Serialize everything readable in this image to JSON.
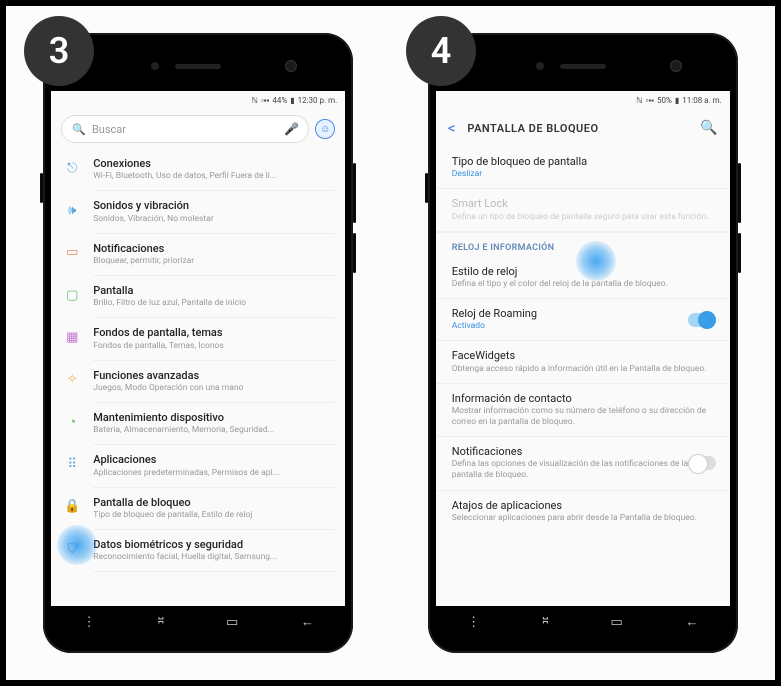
{
  "steps": {
    "s3": "3",
    "s4": "4"
  },
  "screen1": {
    "status": {
      "signalIcon": "📶",
      "battIcon": "▮",
      "battPct": "44%",
      "time": "12:30 p. m."
    },
    "search": {
      "placeholder": "Buscar"
    },
    "items": [
      {
        "title": "Conexiones",
        "sub": "Wi-Fi, Bluetooth, Uso de datos, Perfil Fuera de lí..."
      },
      {
        "title": "Sonidos y vibración",
        "sub": "Sonidos, Vibración, No molestar"
      },
      {
        "title": "Notificaciones",
        "sub": "Bloquear, permitir, priorizar"
      },
      {
        "title": "Pantalla",
        "sub": "Brillo, Filtro de luz azul, Pantalla de inicio"
      },
      {
        "title": "Fondos de pantalla, temas",
        "sub": "Fondos de pantalla, Temas, Íconos"
      },
      {
        "title": "Funciones avanzadas",
        "sub": "Juegos, Modo Operación con una mano"
      },
      {
        "title": "Mantenimiento dispositivo",
        "sub": "Batería, Almacenamiento, Memoria, Seguridad..."
      },
      {
        "title": "Aplicaciones",
        "sub": "Aplicaciones predeterminadas, Permisos de apl..."
      },
      {
        "title": "Pantalla de bloqueo",
        "sub": "Tipo de bloqueo de pantalla, Estilo de reloj"
      },
      {
        "title": "Datos biométricos y seguridad",
        "sub": "Reconocimiento facial, Huella digital, Samsung..."
      }
    ]
  },
  "screen2": {
    "status": {
      "signalIcon": "📶",
      "battIcon": "▮",
      "battPct": "50%",
      "time": "11:08 a. m."
    },
    "header": {
      "title": "PANTALLA DE BLOQUEO"
    },
    "lockType": {
      "title": "Tipo de bloqueo de pantalla",
      "sub": "Deslizar"
    },
    "smartLock": {
      "title": "Smart Lock",
      "sub": "Defina un tipo de bloqueo de pantalla seguro para usar esta función."
    },
    "sectionClock": "RELOJ E INFORMACIÓN",
    "clockStyle": {
      "title": "Estilo de reloj",
      "sub": "Defina el tipo y el color del reloj de la pantalla de bloqueo."
    },
    "roaming": {
      "title": "Reloj de Roaming",
      "sub": "Activado"
    },
    "facewidgets": {
      "title": "FaceWidgets",
      "sub": "Obtenga acceso rápido a información útil en la Pantalla de bloqueo."
    },
    "contact": {
      "title": "Información de contacto",
      "sub": "Mostrar información como su número de teléfono o su dirección de correo en la pantalla de bloqueo."
    },
    "notif": {
      "title": "Notificaciones",
      "sub": "Defina las opciones de visualización de las notificaciones de la pantalla de bloqueo."
    },
    "shortcuts": {
      "title": "Atajos de aplicaciones",
      "sub": "Seleccionar aplicaciones para abrir desde la Pantalla de bloqueo."
    }
  },
  "nav": {
    "recents": "⎌",
    "home": "▢",
    "back": "←"
  }
}
